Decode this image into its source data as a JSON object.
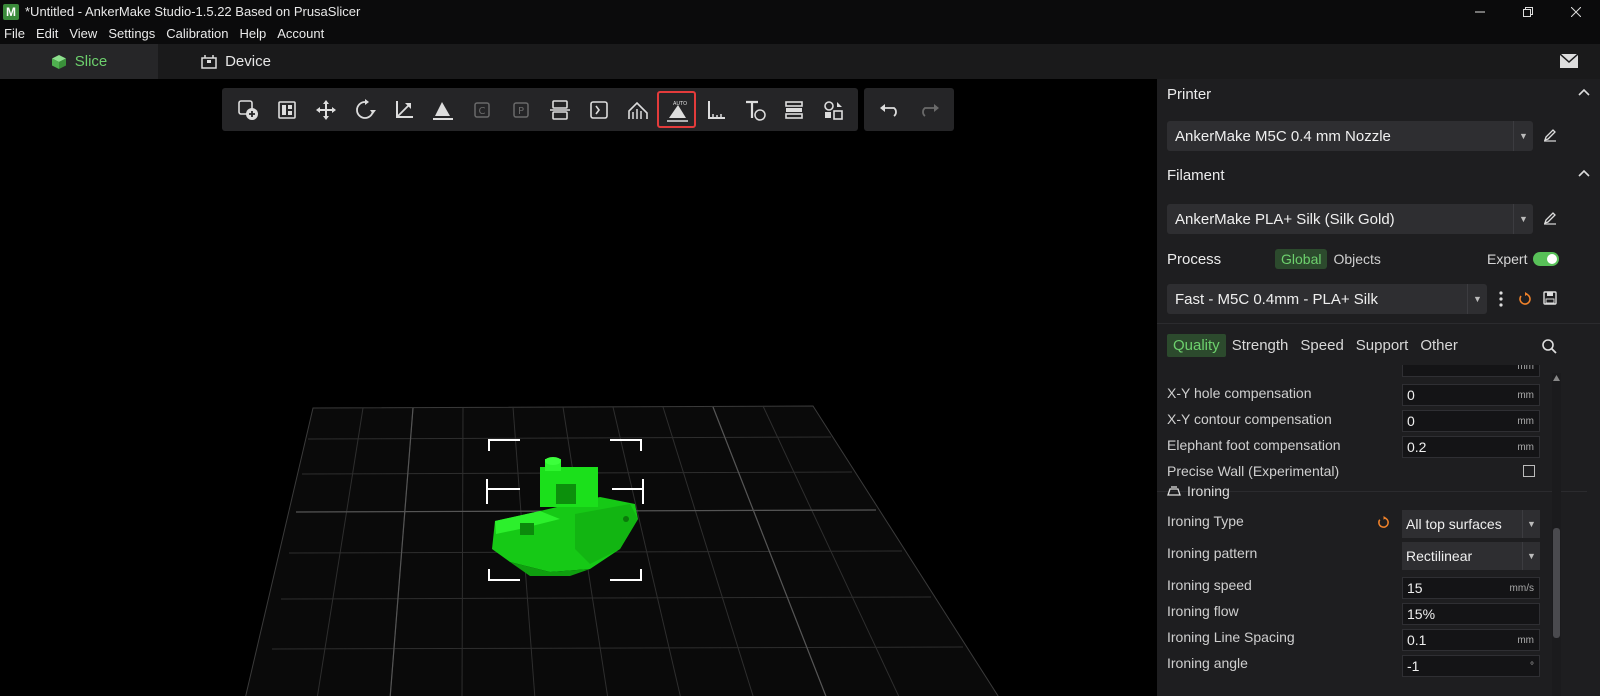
{
  "window": {
    "title": "*Untitled - AnkerMake Studio-1.5.22 Based on PrusaSlicer",
    "logo_letter": "M"
  },
  "menu": [
    "File",
    "Edit",
    "View",
    "Settings",
    "Calibration",
    "Help",
    "Account"
  ],
  "tabs": {
    "slice": "Slice",
    "device": "Device"
  },
  "toolbar": {
    "buttons": [
      "add-object",
      "arrange",
      "move",
      "rotate",
      "scale",
      "lay-on-face",
      "copy",
      "paste",
      "split",
      "cut",
      "support-paint",
      "auto-orient",
      "measure",
      "text",
      "layer-editing",
      "assemble"
    ],
    "active": "auto-orient",
    "auto_label": "AUTO"
  },
  "panel": {
    "printer": {
      "heading": "Printer",
      "value": "AnkerMake M5C 0.4 mm Nozzle"
    },
    "filament": {
      "heading": "Filament",
      "value": "AnkerMake PLA+ Silk (Silk Gold)"
    },
    "process": {
      "heading": "Process",
      "tabs": [
        "Global",
        "Objects"
      ],
      "expert_label": "Expert",
      "preset": "Fast - M5C 0.4mm - PLA+ Silk"
    },
    "categories": [
      "Quality",
      "Strength",
      "Speed",
      "Support",
      "Other"
    ],
    "settings": {
      "resolution_unit": "mm",
      "xy_hole": {
        "label": "X-Y hole compensation",
        "value": "0",
        "unit": "mm"
      },
      "xy_contour": {
        "label": "X-Y contour compensation",
        "value": "0",
        "unit": "mm"
      },
      "elephant": {
        "label": "Elephant foot compensation",
        "value": "0.2",
        "unit": "mm"
      },
      "precise_wall": {
        "label": "Precise Wall (Experimental)"
      },
      "ironing_section": "Ironing",
      "ironing_type": {
        "label": "Ironing Type",
        "value": "All top surfaces"
      },
      "ironing_pattern": {
        "label": "Ironing pattern",
        "value": "Rectilinear"
      },
      "ironing_speed": {
        "label": "Ironing speed",
        "value": "15",
        "unit": "mm/s"
      },
      "ironing_flow": {
        "label": "Ironing flow",
        "value": "15%"
      },
      "ironing_spacing": {
        "label": "Ironing Line Spacing",
        "value": "0.1",
        "unit": "mm"
      },
      "ironing_angle": {
        "label": "Ironing angle",
        "value": "-1",
        "unit": "°"
      }
    }
  },
  "colors": {
    "accent": "#6dd06d",
    "model": "#19e019",
    "highlight": "#e33b3b"
  }
}
